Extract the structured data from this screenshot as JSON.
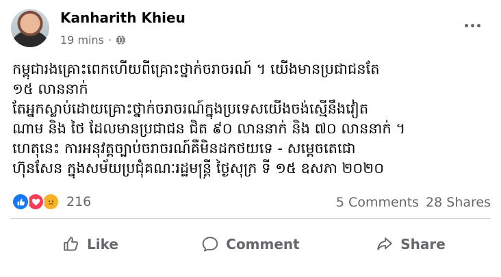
{
  "post": {
    "author": "Kanharith Khieu",
    "time": "19 mins",
    "audience_icon": "globe-icon",
    "menu_icon": "more-horizontal-icon",
    "body_lines": [
      "កម្ពុជារងគ្រោះពេកហើយពីគ្រោះថ្នាក់ចរាចរណ៍ ។ យើងមានប្រជាជនតែ",
      "១៥ លាននាក់",
      "តែអ្នកស្លាប់ដោយគ្រោះថ្នាក់ចរាចរណ៍ក្នុងប្រទេសយើងចង់ស្មើនឹងវៀត",
      "ណាម និង ថៃ ដែលមានប្រជាជន ជិត ៩០ លាននាក់ និង ៧០ លាននាក់ ។",
      "ហេតុនេះ ការអនុវត្តច្បាប់ចរាចរណ៍គឺមិនដកថយទេ - សម្តេចតេជោ",
      "ហ៊ុនសែន ក្នុងសម័យប្រជុំគណៈរដ្ឋមន្ត្រី ថ្ងៃសុក្រ ទី ១៥ ឧសភា ២០២០"
    ]
  },
  "engagement": {
    "reactions": [
      "like",
      "love",
      "sad"
    ],
    "reaction_count": "216",
    "comments": "5 Comments",
    "shares": "28 Shares"
  },
  "actions": {
    "like": "Like",
    "comment": "Comment",
    "share": "Share"
  },
  "colors": {
    "primary_text": "#050505",
    "secondary_text": "#65676b",
    "like_blue": "#1877f2",
    "love_red": "#f33e58",
    "sad_yellow": "#f7b125",
    "divider": "#ced0d4"
  }
}
